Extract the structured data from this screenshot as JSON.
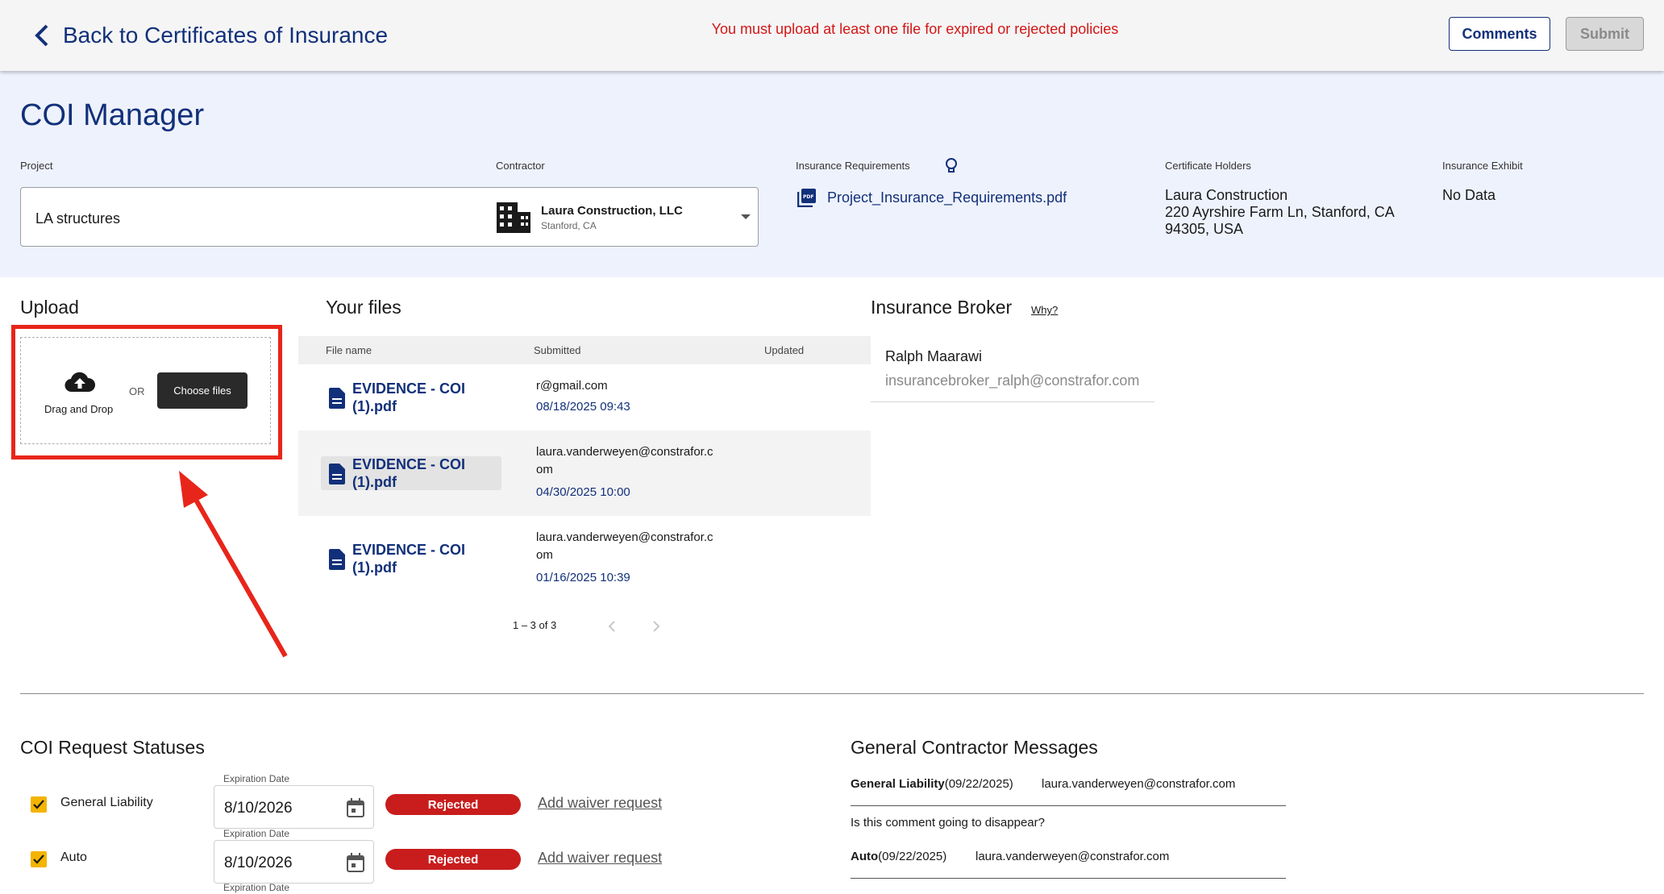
{
  "header": {
    "back_label": "Back to Certificates of Insurance",
    "warning": "You must upload at least one file for expired or rejected policies",
    "comments_label": "Comments",
    "submit_label": "Submit"
  },
  "overview": {
    "title": "COI Manager",
    "project_label": "Project",
    "project_value": "LA structures",
    "contractor_label": "Contractor",
    "contractor_name": "Laura Construction, LLC",
    "contractor_location": "Stanford, CA",
    "insurance_requirements_label": "Insurance Requirements",
    "insurance_requirements_file": "Project_Insurance_Requirements.pdf",
    "certificate_holders_label": "Certificate Holders",
    "certificate_holder_lines": [
      "Laura Construction",
      "220 Ayrshire Farm Ln, Stanford, CA",
      "94305, USA"
    ],
    "insurance_exhibit_label": "Insurance Exhibit",
    "insurance_exhibit_value": "No Data"
  },
  "upload": {
    "title": "Upload",
    "drag_label": "Drag and Drop",
    "or_label": "OR",
    "choose_label": "Choose files"
  },
  "files": {
    "title": "Your files",
    "columns": [
      "File name",
      "Submitted",
      "Updated"
    ],
    "rows": [
      {
        "name_lines": [
          "EVIDENCE - COI",
          "(1).pdf"
        ],
        "email_lines": [
          "r@gmail.com"
        ],
        "date": "08/18/2025 09:43"
      },
      {
        "name_lines": [
          "EVIDENCE - COI",
          "(1).pdf"
        ],
        "email_lines": [
          "laura.vanderweyen@constrafor.c",
          "om"
        ],
        "date": "04/30/2025 10:00"
      },
      {
        "name_lines": [
          "EVIDENCE - COI",
          "(1).pdf"
        ],
        "email_lines": [
          "laura.vanderweyen@constrafor.c",
          "om"
        ],
        "date": "01/16/2025 10:39"
      }
    ],
    "pagination": "1 – 3 of 3"
  },
  "broker": {
    "title": "Insurance Broker",
    "why_label": "Why?",
    "name": "Ralph Maarawi",
    "email": "insurancebroker_ralph@constrafor.com"
  },
  "statuses": {
    "title": "COI Request Statuses",
    "expiration_label": "Expiration Date",
    "items": [
      {
        "name": "General Liability",
        "date": "8/10/2026",
        "status": "Rejected",
        "waiver": "Add waiver request"
      },
      {
        "name": "Auto",
        "date": "8/10/2026",
        "status": "Rejected",
        "waiver": "Add waiver request"
      }
    ]
  },
  "messages": {
    "title": "General Contractor Messages",
    "items": [
      {
        "policy": "General Liability",
        "date": "(09/22/2025)",
        "author": "laura.vanderweyen@constrafor.com",
        "text": "Is this comment going to disappear?"
      },
      {
        "policy": "Auto",
        "date": "(09/22/2025)",
        "author": "laura.vanderweyen@constrafor.com",
        "text": ""
      }
    ]
  },
  "colors": {
    "brand_navy": "#12307a",
    "warning_red": "#d41616",
    "rejected_red": "#c91d1d",
    "checkbox_yellow": "#f4b400",
    "annotation_red": "#e8251a"
  },
  "icons": [
    "chevron-left-icon",
    "building-icon",
    "dropdown-caret-icon",
    "pdf-file-icon",
    "lightbulb-icon",
    "cloud-upload-icon",
    "document-icon",
    "chevron-right-icon",
    "calendar-icon",
    "check-icon"
  ]
}
